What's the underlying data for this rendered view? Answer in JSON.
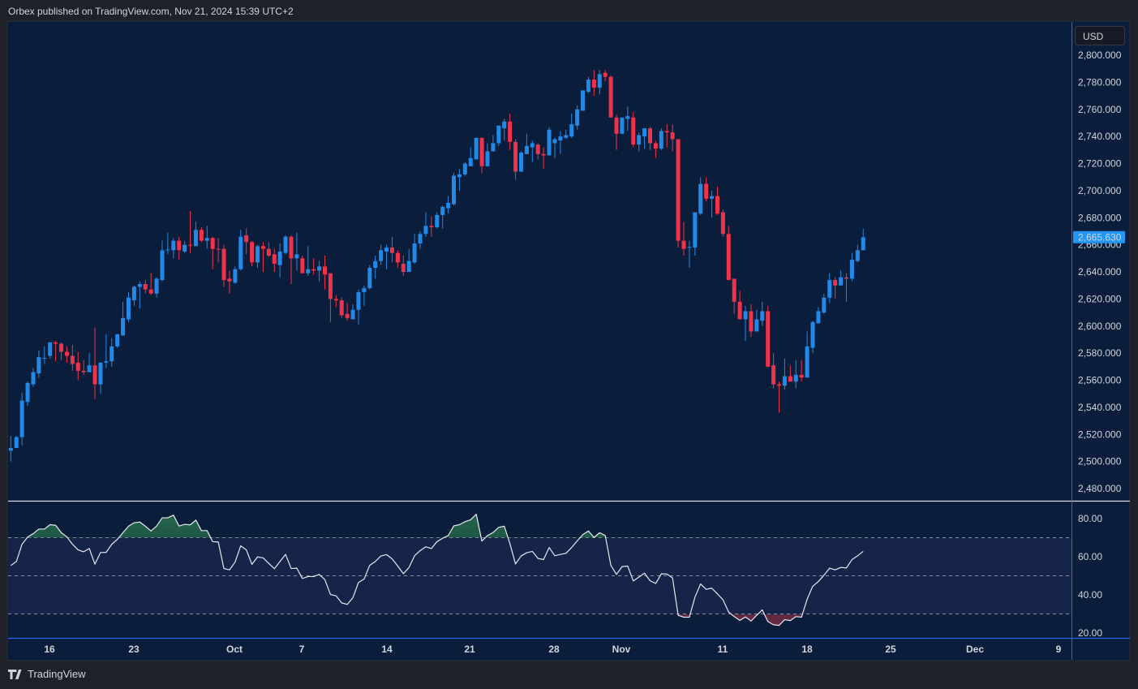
{
  "header": {
    "published": "Orbex published on TradingView.com, Nov 21, 2024 15:39 UTC+2"
  },
  "currency_button": "USD",
  "footer": {
    "logo_text": "TradingView",
    "logo_icon": "tradingview-logo-icon"
  },
  "colors": {
    "background": "#0a1e3b",
    "up": "#2189e8",
    "down": "#f0334a",
    "rsi_line": "#e6e8ef",
    "rsi_band": "#172449",
    "last_price": "#2196f3"
  },
  "chart_data": [
    {
      "type": "candlestick",
      "ylabel": "",
      "ylim": [
        2470,
        2812
      ],
      "yticks": [
        "2,800.000",
        "2,780.000",
        "2,760.000",
        "2,740.000",
        "2,720.000",
        "2,700.000",
        "2,680.000",
        "2,660.000",
        "2,640.000",
        "2,620.000",
        "2,600.000",
        "2,580.000",
        "2,560.000",
        "2,540.000",
        "2,520.000",
        "2,500.000",
        "2,480.000"
      ],
      "last_price_label": "2,665.630",
      "xticks": [
        "16",
        "23",
        "Oct",
        "7",
        "14",
        "21",
        "28",
        "Nov",
        "11",
        "18",
        "25",
        "Dec",
        "9"
      ],
      "grid": false,
      "ohlc_fields": [
        "open",
        "high",
        "low",
        "close"
      ],
      "ohlc": [
        [
          2508,
          2519,
          2500,
          2510
        ],
        [
          2510,
          2519,
          2510,
          2518
        ],
        [
          2518,
          2551,
          2512,
          2545
        ],
        [
          2544,
          2559,
          2541,
          2558
        ],
        [
          2557,
          2569,
          2555,
          2566
        ],
        [
          2565,
          2582,
          2562,
          2577
        ],
        [
          2576,
          2585,
          2572,
          2576.5
        ],
        [
          2578,
          2588,
          2576,
          2588
        ],
        [
          2588,
          2589,
          2574,
          2587
        ],
        [
          2587,
          2588,
          2575,
          2581
        ],
        [
          2581,
          2585,
          2573,
          2578
        ],
        [
          2578,
          2586,
          2567,
          2572
        ],
        [
          2573,
          2581,
          2560,
          2567
        ],
        [
          2567,
          2575,
          2564,
          2566
        ],
        [
          2566,
          2580,
          2566,
          2571
        ],
        [
          2571,
          2599,
          2546,
          2557
        ],
        [
          2557,
          2573,
          2550,
          2573
        ],
        [
          2573,
          2594,
          2569,
          2574
        ],
        [
          2574,
          2591,
          2570,
          2585
        ],
        [
          2585,
          2594,
          2584,
          2594
        ],
        [
          2593,
          2618,
          2593,
          2606
        ],
        [
          2605,
          2625,
          2603,
          2621
        ],
        [
          2619,
          2630,
          2615,
          2629
        ],
        [
          2629,
          2633,
          2613,
          2631
        ],
        [
          2631,
          2634,
          2624,
          2627
        ],
        [
          2627,
          2639,
          2623,
          2624
        ],
        [
          2624,
          2636,
          2621,
          2635
        ],
        [
          2634,
          2663,
          2633,
          2656
        ],
        [
          2656,
          2669,
          2653,
          2656.5
        ],
        [
          2656,
          2665,
          2650,
          2663
        ],
        [
          2663,
          2666,
          2649,
          2656
        ],
        [
          2655,
          2663,
          2654,
          2660
        ],
        [
          2660,
          2685,
          2654,
          2659.5
        ],
        [
          2659,
          2677,
          2659,
          2671
        ],
        [
          2671,
          2673,
          2662,
          2663
        ],
        [
          2663,
          2674,
          2657,
          2665
        ],
        [
          2665,
          2666,
          2642,
          2657
        ],
        [
          2657,
          2665,
          2647,
          2656.5
        ],
        [
          2657,
          2660,
          2629,
          2634
        ],
        [
          2635,
          2641,
          2624,
          2633
        ],
        [
          2632,
          2644,
          2631,
          2642
        ],
        [
          2642,
          2671,
          2641,
          2666
        ],
        [
          2667,
          2672,
          2653,
          2662
        ],
        [
          2662,
          2663,
          2644,
          2647
        ],
        [
          2647,
          2660,
          2643,
          2659
        ],
        [
          2659,
          2662,
          2640,
          2657
        ],
        [
          2657,
          2662,
          2651,
          2652
        ],
        [
          2653,
          2657,
          2640,
          2646
        ],
        [
          2645,
          2661,
          2636,
          2655
        ],
        [
          2654,
          2667,
          2653,
          2666
        ],
        [
          2666,
          2667,
          2631,
          2650
        ],
        [
          2650,
          2669,
          2641,
          2653
        ],
        [
          2650,
          2652,
          2639,
          2639
        ],
        [
          2639,
          2659,
          2637,
          2642
        ],
        [
          2642,
          2650,
          2638,
          2641
        ],
        [
          2641,
          2648,
          2633,
          2644
        ],
        [
          2644,
          2652,
          2627,
          2638
        ],
        [
          2639,
          2639,
          2603,
          2620
        ],
        [
          2620,
          2623,
          2614,
          2619
        ],
        [
          2619,
          2621,
          2606,
          2608
        ],
        [
          2609,
          2617,
          2604,
          2606
        ],
        [
          2605,
          2616,
          2605,
          2612
        ],
        [
          2612,
          2627,
          2601,
          2625
        ],
        [
          2625,
          2630,
          2615,
          2628
        ],
        [
          2628,
          2645,
          2627,
          2643
        ],
        [
          2643,
          2652,
          2635,
          2648
        ],
        [
          2648,
          2660,
          2645,
          2656
        ],
        [
          2655,
          2660,
          2642,
          2658
        ],
        [
          2658,
          2666,
          2647,
          2654
        ],
        [
          2654,
          2656,
          2643,
          2647
        ],
        [
          2646,
          2652,
          2637,
          2640
        ],
        [
          2640,
          2657,
          2640,
          2648
        ],
        [
          2647,
          2668,
          2646,
          2661
        ],
        [
          2661,
          2670,
          2657,
          2668
        ],
        [
          2668,
          2684,
          2666,
          2674
        ],
        [
          2674,
          2681,
          2666,
          2673
        ],
        [
          2673,
          2684,
          2672,
          2682
        ],
        [
          2682,
          2689,
          2672,
          2688
        ],
        [
          2687,
          2696,
          2683,
          2691
        ],
        [
          2690,
          2713,
          2689,
          2711
        ],
        [
          2710,
          2716,
          2700,
          2712
        ],
        [
          2712,
          2721,
          2711,
          2720
        ],
        [
          2718,
          2732,
          2718,
          2724
        ],
        [
          2723,
          2739,
          2723,
          2739
        ],
        [
          2739,
          2739,
          2713,
          2718
        ],
        [
          2718,
          2735,
          2718,
          2729
        ],
        [
          2729,
          2741,
          2729,
          2735
        ],
        [
          2735,
          2748,
          2733,
          2748
        ],
        [
          2746,
          2753,
          2737,
          2751
        ],
        [
          2751,
          2757,
          2730,
          2736
        ],
        [
          2736,
          2738,
          2708,
          2714
        ],
        [
          2714,
          2729,
          2714,
          2728
        ],
        [
          2727,
          2742,
          2727,
          2733
        ],
        [
          2732,
          2737,
          2721,
          2735
        ],
        [
          2734,
          2735,
          2723,
          2727
        ],
        [
          2727,
          2732,
          2716,
          2726
        ],
        [
          2726,
          2747,
          2726,
          2745
        ],
        [
          2735,
          2739,
          2724,
          2738
        ],
        [
          2737,
          2744,
          2727,
          2740
        ],
        [
          2739,
          2745,
          2738,
          2741
        ],
        [
          2740,
          2757,
          2739,
          2749
        ],
        [
          2748,
          2763,
          2745,
          2760
        ],
        [
          2759,
          2774,
          2759,
          2774
        ],
        [
          2773,
          2784,
          2772,
          2782
        ],
        [
          2782,
          2789,
          2770,
          2776
        ],
        [
          2776,
          2789,
          2771,
          2786
        ],
        [
          2787,
          2789,
          2781,
          2784
        ],
        [
          2784,
          2785,
          2754,
          2754
        ],
        [
          2754,
          2756,
          2730,
          2742
        ],
        [
          2742,
          2754,
          2742,
          2754
        ],
        [
          2753,
          2762,
          2744,
          2755
        ],
        [
          2754,
          2758,
          2732,
          2734
        ],
        [
          2734,
          2743,
          2729,
          2741
        ],
        [
          2740,
          2746,
          2731,
          2746
        ],
        [
          2746,
          2747,
          2730,
          2735
        ],
        [
          2735,
          2737,
          2724,
          2731
        ],
        [
          2731,
          2746,
          2730,
          2744
        ],
        [
          2744,
          2749,
          2732,
          2743
        ],
        [
          2743,
          2749,
          2729,
          2738
        ],
        [
          2738,
          2738,
          2658,
          2663
        ],
        [
          2663,
          2677,
          2652,
          2657
        ],
        [
          2658,
          2663,
          2643,
          2658.5
        ],
        [
          2658,
          2684,
          2652,
          2684
        ],
        [
          2683,
          2710,
          2682,
          2705
        ],
        [
          2705,
          2710,
          2692,
          2694
        ],
        [
          2694,
          2700,
          2680,
          2696
        ],
        [
          2696,
          2703,
          2682,
          2683
        ],
        [
          2684,
          2686,
          2666,
          2668
        ],
        [
          2668,
          2674,
          2634,
          2634
        ],
        [
          2635,
          2635,
          2609,
          2618
        ],
        [
          2618,
          2626,
          2605,
          2605
        ],
        [
          2605,
          2615,
          2589,
          2611
        ],
        [
          2611,
          2616,
          2592,
          2596
        ],
        [
          2596,
          2612,
          2596,
          2605
        ],
        [
          2604,
          2618,
          2600,
          2611
        ],
        [
          2611,
          2615,
          2570,
          2570
        ],
        [
          2571,
          2580,
          2554,
          2557
        ],
        [
          2557,
          2559,
          2536,
          2556
        ],
        [
          2556,
          2576,
          2553,
          2563
        ],
        [
          2563,
          2571,
          2559,
          2559
        ],
        [
          2559,
          2575,
          2554,
          2564
        ],
        [
          2564,
          2575,
          2559,
          2562
        ],
        [
          2562,
          2596,
          2562,
          2585
        ],
        [
          2584,
          2604,
          2580,
          2603
        ],
        [
          2602,
          2614,
          2602,
          2611
        ],
        [
          2610,
          2624,
          2609,
          2621
        ],
        [
          2621,
          2639,
          2617,
          2634
        ],
        [
          2634,
          2636,
          2620,
          2630
        ],
        [
          2630,
          2641,
          2630,
          2636
        ],
        [
          2636,
          2639,
          2618,
          2635
        ],
        [
          2635,
          2654,
          2633,
          2649
        ],
        [
          2648,
          2660,
          2647,
          2656
        ],
        [
          2656,
          2672,
          2656,
          2665.63
        ]
      ]
    },
    {
      "type": "line",
      "ylim": [
        16,
        88
      ],
      "yticks": [
        "80.00",
        "60.00",
        "40.00",
        "20.00"
      ],
      "levels": [
        70,
        50,
        30
      ],
      "values": [
        55.4,
        57.5,
        66.5,
        70.3,
        72.1,
        74.5,
        74.5,
        76.8,
        76.5,
        72.6,
        70.4,
        66.5,
        63.6,
        62.6,
        64.3,
        56.1,
        62.2,
        62.3,
        66.5,
        69.1,
        72.6,
        76.0,
        77.8,
        78.2,
        76.0,
        73.5,
        76.1,
        80.4,
        80.4,
        81.8,
        76.1,
        77.0,
        76.7,
        79.2,
        73.7,
        73.7,
        67.9,
        67.7,
        53.8,
        53.1,
        57.2,
        65.7,
        63.6,
        56.0,
        59.9,
        59.4,
        56.5,
        53.7,
        57.5,
        61.2,
        53.8,
        54.0,
        48.6,
        49.6,
        49.6,
        50.7,
        48.0,
        40.2,
        39.5,
        35.8,
        35.0,
        38.5,
        46.5,
        48.3,
        55.5,
        57.5,
        60.4,
        61.1,
        58.9,
        55.1,
        51.1,
        54.3,
        60.5,
        63.2,
        65.2,
        64.3,
        67.9,
        69.7,
        71.1,
        76.2,
        76.8,
        78.4,
        79.4,
        82.3,
        68.2,
        71.1,
        72.7,
        75.4,
        76.0,
        66.9,
        56.2,
        60.4,
        62.1,
        62.8,
        59.1,
        58.5,
        64.8,
        60.5,
        61.2,
        61.8,
        64.8,
        68.3,
        71.6,
        73.5,
        70.1,
        72.6,
        71.1,
        55.5,
        50.7,
        54.8,
        55.1,
        47.3,
        49.3,
        51.4,
        47.4,
        46.0,
        51.0,
        50.9,
        48.9,
        29.3,
        28.3,
        28.3,
        38.8,
        45.7,
        42.9,
        43.5,
        40.5,
        37.4,
        31.0,
        28.6,
        26.6,
        28.4,
        26.3,
        29.3,
        32.1,
        26.0,
        24.3,
        24.0,
        27.0,
        26.5,
        28.6,
        28.3,
        37.7,
        44.5,
        47.0,
        50.3,
        54.0,
        53.1,
        54.4,
        54.1,
        58.5,
        60.5,
        62.8
      ]
    }
  ]
}
